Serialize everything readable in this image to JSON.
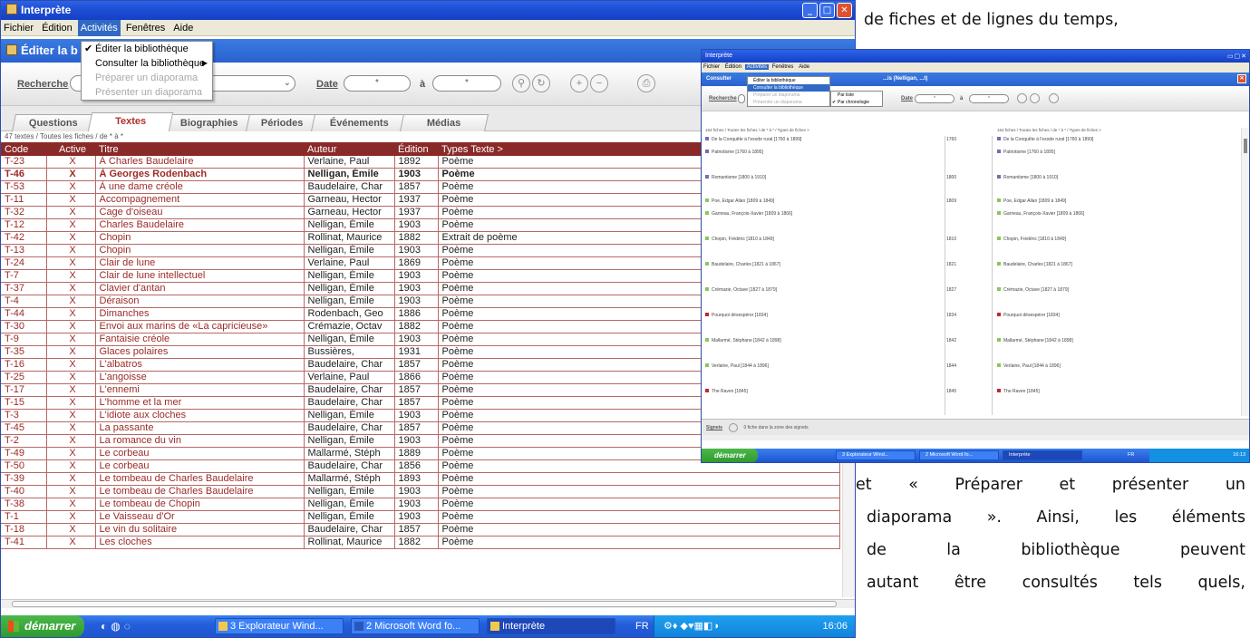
{
  "doc": {
    "line_top": "de fiches et de lignes du temps,",
    "lines_bottom": [
      {
        "words": [
          "et",
          "«",
          "Préparer",
          "et",
          "présenter",
          "un"
        ]
      },
      {
        "words": [
          "diaporama",
          "».",
          "Ainsi,",
          "les",
          "éléments"
        ]
      },
      {
        "words": [
          "de",
          "la",
          "bibliothèque",
          "peuvent"
        ]
      },
      {
        "words": [
          "autant",
          "être",
          "consultés",
          "tels",
          "quels,"
        ]
      }
    ]
  },
  "win1": {
    "title": "Interprète",
    "menu": [
      "Fichier",
      "Édition",
      "Activités",
      "Fenêtres",
      "Aide"
    ],
    "dropdown": [
      {
        "label": "Éditer la bibliothèque",
        "check": "✔",
        "arrow": "",
        "disabled": false
      },
      {
        "label": "Consulter la bibliothèque",
        "check": "",
        "arrow": "▶",
        "disabled": false
      },
      {
        "label": "Préparer un diaporama",
        "check": "",
        "arrow": "",
        "disabled": true
      },
      {
        "label": "Présenter un diaporama",
        "check": "",
        "arrow": "",
        "disabled": true
      }
    ],
    "subwindow_title": "Éditer la b",
    "toolbar": {
      "search": "Recherche",
      "date": "Date",
      "a": "à",
      "star1": "*",
      "star2": "*"
    },
    "tabs": [
      "Questions",
      "Textes",
      "Biographies",
      "Périodes",
      "Événements",
      "Médias"
    ],
    "status": "47 textes / Toutes les fiches / de * à *",
    "columns": [
      "Code",
      "Active",
      "Titre",
      "Auteur",
      "Édition",
      "Types Texte >"
    ],
    "rows": [
      [
        "T-23",
        "X",
        "À Charles Baudelaire",
        "Verlaine, Paul",
        "1892",
        "Poème"
      ],
      [
        "T-46",
        "X",
        "À Georges Rodenbach",
        "Nelligan, Émile",
        "1903",
        "Poème"
      ],
      [
        "T-53",
        "X",
        "À une dame créole",
        "Baudelaire, Char",
        "1857",
        "Poème"
      ],
      [
        "T-11",
        "X",
        "Accompagnement",
        "Garneau, Hector",
        "1937",
        "Poème"
      ],
      [
        "T-32",
        "X",
        "Cage d'oiseau",
        "Garneau, Hector",
        "1937",
        "Poème"
      ],
      [
        "T-12",
        "X",
        "Charles Baudelaire",
        "Nelligan, Émile",
        "1903",
        "Poème"
      ],
      [
        "T-42",
        "X",
        "Chopin",
        "Rollinat, Maurice",
        "1882",
        "Extrait de poème"
      ],
      [
        "T-13",
        "X",
        "Chopin",
        "Nelligan, Émile",
        "1903",
        "Poème"
      ],
      [
        "T-24",
        "X",
        "Clair de lune",
        "Verlaine, Paul",
        "1869",
        "Poème"
      ],
      [
        "T-7",
        "X",
        "Clair de lune intellectuel",
        "Nelligan, Émile",
        "1903",
        "Poème"
      ],
      [
        "T-37",
        "X",
        "Clavier d'antan",
        "Nelligan, Émile",
        "1903",
        "Poème"
      ],
      [
        "T-4",
        "X",
        "Déraison",
        "Nelligan, Émile",
        "1903",
        "Poème"
      ],
      [
        "T-44",
        "X",
        "Dimanches",
        "Rodenbach, Geo",
        "1886",
        "Poème"
      ],
      [
        "T-30",
        "X",
        "Envoi aux marins de «La capricieuse»",
        "Crémazie, Octav",
        "1882",
        "Poème"
      ],
      [
        "T-9",
        "X",
        "Fantaisie créole",
        "Nelligan, Émile",
        "1903",
        "Poème"
      ],
      [
        "T-35",
        "X",
        "Glaces polaires",
        "Bussières,",
        "1931",
        "Poème"
      ],
      [
        "T-16",
        "X",
        "L'albatros",
        "Baudelaire, Char",
        "1857",
        "Poème"
      ],
      [
        "T-25",
        "X",
        "L'angoisse",
        "Verlaine, Paul",
        "1866",
        "Poème"
      ],
      [
        "T-17",
        "X",
        "L'ennemi",
        "Baudelaire, Char",
        "1857",
        "Poème"
      ],
      [
        "T-15",
        "X",
        "L'homme et la mer",
        "Baudelaire, Char",
        "1857",
        "Poème"
      ],
      [
        "T-3",
        "X",
        "L'idiote aux cloches",
        "Nelligan, Émile",
        "1903",
        "Poème"
      ],
      [
        "T-45",
        "X",
        "La passante",
        "Baudelaire, Char",
        "1857",
        "Poème"
      ],
      [
        "T-2",
        "X",
        "La romance du vin",
        "Nelligan, Émile",
        "1903",
        "Poème"
      ],
      [
        "T-49",
        "X",
        "Le corbeau",
        "Mallarmé, Stéph",
        "1889",
        "Poème"
      ],
      [
        "T-50",
        "X",
        "Le corbeau",
        "Baudelaire, Char",
        "1856",
        "Poème"
      ],
      [
        "T-39",
        "X",
        "Le tombeau de Charles Baudelaire",
        "Mallarmé, Stéph",
        "1893",
        "Poème"
      ],
      [
        "T-40",
        "X",
        "Le tombeau de Charles Baudelaire",
        "Nelligan, Émile",
        "1903",
        "Poème"
      ],
      [
        "T-38",
        "X",
        "Le tombeau de Chopin",
        "Nelligan, Émile",
        "1903",
        "Poème"
      ],
      [
        "T-1",
        "X",
        "Le Vaisseau d'Or",
        "Nelligan, Émile",
        "1903",
        "Poème"
      ],
      [
        "T-18",
        "X",
        "Le vin du solitaire",
        "Baudelaire, Char",
        "1857",
        "Poème"
      ],
      [
        "T-41",
        "X",
        "Les cloches",
        "Rollinat, Maurice",
        "1882",
        "Poème"
      ]
    ],
    "taskbar": {
      "start": "démarrer",
      "items": [
        "3 Explorateur Wind...",
        "2 Microsoft Word fo...",
        "Interprète"
      ],
      "lang": "FR",
      "clock": "16:06"
    }
  },
  "win2": {
    "title": "Interprète",
    "menu": [
      "Fichier",
      "Édition",
      "Activités",
      "Fenêtres",
      "Aide"
    ],
    "subwindow_title": "Consulter",
    "subwindow_tail": "...is (Nelligan, ...t)",
    "dropdown": [
      "Éditer la bibliothèque",
      "Consulter la bibliothèque",
      "Préparer un diaporama",
      "Présenter un diaporama"
    ],
    "submenu": [
      {
        "label": "Par liste",
        "check": ""
      },
      {
        "label": "Par chronologie",
        "check": "✔"
      }
    ],
    "toolbar": {
      "search": "Recherche",
      "date": "Date",
      "a": "à",
      "star": "*"
    },
    "status_left": "164 fiches / Toutes les fiches / de * à * / Types de fiches >",
    "status_right": "164 fiches / Toutes les fiches / de * à * / Types de fiches >",
    "left_items": [
      {
        "label": "De la Conquête à l'exode rural [1760 à 1899]",
        "color": "#7a6ab0"
      },
      {
        "label": "Patriotisme [1760 à 1895]",
        "color": "#7a6ab0"
      },
      {
        "label": "Romantisme [1800 à 1910]",
        "color": "#7a6ab0"
      },
      {
        "label": "Poe, Edgar Allan [1809 à 1849]",
        "color": "#8ec45a"
      },
      {
        "label": "Garneau, François-Xavier [1809 à 1866]",
        "color": "#8ec45a"
      },
      {
        "label": "Chopin, Frédéric [1810 à 1849]",
        "color": "#8ec45a"
      },
      {
        "label": "Baudelaire, Charles [1821 à 1867]",
        "color": "#8ec45a"
      },
      {
        "label": "Crémazie, Octave [1827 à 1879]",
        "color": "#8ec45a"
      },
      {
        "label": "Pourquoi désespérer [1834]",
        "color": "#c0282a"
      },
      {
        "label": "Mallarmé, Stéphane [1842 à 1898]",
        "color": "#8ec45a"
      },
      {
        "label": "Verlaine, Paul [1844 à 1896]",
        "color": "#8ec45a"
      },
      {
        "label": "The Raven [1845]",
        "color": "#c0282a"
      }
    ],
    "years": [
      "1760",
      "1800",
      "1809",
      "1810",
      "1821",
      "1827",
      "1834",
      "1842",
      "1844",
      "1845"
    ],
    "signets": "Signets",
    "signets_text": "0 fiche dans la zone des signets",
    "taskbar": {
      "start": "démarrer",
      "items": [
        "3 Explorateur Wind...",
        "2 Microsoft Word fo...",
        "Interprète"
      ],
      "lang": "FR",
      "clock": "16:13"
    }
  }
}
